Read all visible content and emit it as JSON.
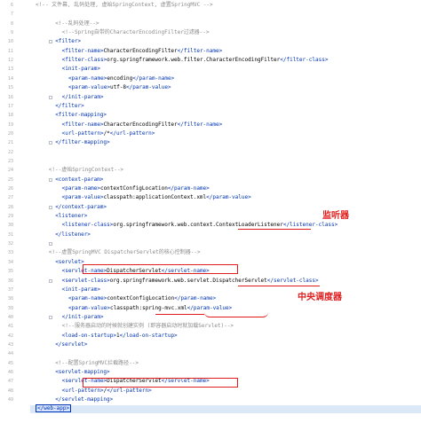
{
  "editor": {
    "line_numbers": [
      "6",
      "7",
      "8",
      "9",
      "10",
      "11",
      "12",
      "13",
      "14",
      "15",
      "16",
      "17",
      "18",
      "19",
      "20",
      "21",
      "22",
      "23",
      "24",
      "25",
      "26",
      "27",
      "28",
      "29",
      "30",
      "31",
      "32",
      "33",
      "34",
      "35",
      "36",
      "37",
      "38",
      "39",
      "40",
      "41",
      "42",
      "43",
      "44",
      "45",
      "46",
      "47",
      "48",
      "49"
    ],
    "lines": [
      {
        "kind": "comment",
        "indent": 0,
        "parts": [
          {
            "t": "com",
            "v": "<!-- 文件幕, 乱码处理, 虚始SpringContext, 虚置SpringMVC -->"
          }
        ]
      },
      {
        "kind": "blank",
        "indent": 0,
        "parts": []
      },
      {
        "kind": "code",
        "indent": 6,
        "parts": [
          {
            "t": "com",
            "v": "<!--乱码处理-->"
          }
        ]
      },
      {
        "kind": "code",
        "indent": 8,
        "parts": [
          {
            "t": "com",
            "v": "<!--Spring自带的CharacterEncodingFilter过滤器-->"
          }
        ]
      },
      {
        "kind": "code",
        "indent": 6,
        "parts": [
          {
            "t": "tag",
            "v": "<filter>"
          }
        ]
      },
      {
        "kind": "code",
        "indent": 8,
        "parts": [
          {
            "t": "tag",
            "v": "<filter-name>"
          },
          {
            "t": "txt",
            "v": "CharacterEncodingFilter"
          },
          {
            "t": "tag",
            "v": "</filter-name>"
          }
        ]
      },
      {
        "kind": "code",
        "indent": 8,
        "parts": [
          {
            "t": "tag",
            "v": "<filter-class>"
          },
          {
            "t": "txt",
            "v": "org.springframework.web.filter.CharacterEncodingFilter"
          },
          {
            "t": "tag",
            "v": "</filter-class>"
          }
        ]
      },
      {
        "kind": "code",
        "indent": 8,
        "parts": [
          {
            "t": "tag",
            "v": "<init-param>"
          }
        ]
      },
      {
        "kind": "code",
        "indent": 10,
        "parts": [
          {
            "t": "tag",
            "v": "<param-name>"
          },
          {
            "t": "txt",
            "v": "encoding"
          },
          {
            "t": "tag",
            "v": "</param-name>"
          }
        ]
      },
      {
        "kind": "code",
        "indent": 10,
        "parts": [
          {
            "t": "tag",
            "v": "<param-value>"
          },
          {
            "t": "txt",
            "v": "utf-8"
          },
          {
            "t": "tag",
            "v": "</param-value>"
          }
        ]
      },
      {
        "kind": "code",
        "indent": 8,
        "parts": [
          {
            "t": "tag",
            "v": "</init-param>"
          }
        ]
      },
      {
        "kind": "code",
        "indent": 6,
        "parts": [
          {
            "t": "tag",
            "v": "</filter>"
          }
        ]
      },
      {
        "kind": "code",
        "indent": 6,
        "parts": [
          {
            "t": "tag",
            "v": "<filter-mapping>"
          }
        ]
      },
      {
        "kind": "code",
        "indent": 8,
        "parts": [
          {
            "t": "tag",
            "v": "<filter-name>"
          },
          {
            "t": "txt",
            "v": "CharacterEncodingFilter"
          },
          {
            "t": "tag",
            "v": "</filter-name>"
          }
        ]
      },
      {
        "kind": "code",
        "indent": 8,
        "parts": [
          {
            "t": "tag",
            "v": "<url-pattern>"
          },
          {
            "t": "txt",
            "v": "/*"
          },
          {
            "t": "tag",
            "v": "</url-pattern>"
          }
        ]
      },
      {
        "kind": "code",
        "indent": 6,
        "parts": [
          {
            "t": "tag",
            "v": "</filter-mapping>"
          }
        ]
      },
      {
        "kind": "blank",
        "indent": 0,
        "parts": []
      },
      {
        "kind": "blank",
        "indent": 0,
        "parts": []
      },
      {
        "kind": "code",
        "indent": 4,
        "parts": [
          {
            "t": "com",
            "v": "<!--虚始SpringContext-->"
          }
        ]
      },
      {
        "kind": "code",
        "indent": 6,
        "parts": [
          {
            "t": "tag",
            "v": "<context-param>"
          }
        ]
      },
      {
        "kind": "code",
        "indent": 8,
        "parts": [
          {
            "t": "tag",
            "v": "<param-name>"
          },
          {
            "t": "txt",
            "v": "contextConfigLocation"
          },
          {
            "t": "tag",
            "v": "</param-name>"
          }
        ]
      },
      {
        "kind": "code",
        "indent": 8,
        "parts": [
          {
            "t": "tag",
            "v": "<param-value>"
          },
          {
            "t": "txt",
            "v": "classpath:applicationContext.xml"
          },
          {
            "t": "tag",
            "v": "</param-value>"
          }
        ]
      },
      {
        "kind": "code",
        "indent": 6,
        "parts": [
          {
            "t": "tag",
            "v": "</context-param>"
          }
        ]
      },
      {
        "kind": "code",
        "indent": 6,
        "parts": [
          {
            "t": "tag",
            "v": "<listener>"
          }
        ]
      },
      {
        "kind": "code",
        "indent": 8,
        "parts": [
          {
            "t": "tag",
            "v": "<listener-class>"
          },
          {
            "t": "txt",
            "v": "org.springframework.web.context.ContextLoaderListener"
          },
          {
            "t": "tag",
            "v": "</listener-class>"
          }
        ]
      },
      {
        "kind": "code",
        "indent": 6,
        "parts": [
          {
            "t": "tag",
            "v": "</listener>"
          }
        ]
      },
      {
        "kind": "blank",
        "indent": 0,
        "parts": []
      },
      {
        "kind": "code",
        "indent": 4,
        "parts": [
          {
            "t": "com",
            "v": "<!--虚置SpringMVC DispatcherServlet的核心控制器-->"
          }
        ]
      },
      {
        "kind": "code",
        "indent": 6,
        "parts": [
          {
            "t": "tag",
            "v": "<servlet>"
          }
        ]
      },
      {
        "kind": "code",
        "indent": 8,
        "parts": [
          {
            "t": "tag",
            "v": "<servlet-name>"
          },
          {
            "t": "txt",
            "v": "DispatcherServlet"
          },
          {
            "t": "tag",
            "v": "</servlet-name>"
          }
        ]
      },
      {
        "kind": "code",
        "indent": 8,
        "parts": [
          {
            "t": "tag",
            "v": "<servlet-class>"
          },
          {
            "t": "txt",
            "v": "org.springframework.web.servlet.DispatcherServlet"
          },
          {
            "t": "tag",
            "v": "</servlet-class>"
          }
        ]
      },
      {
        "kind": "code",
        "indent": 8,
        "parts": [
          {
            "t": "tag",
            "v": "<init-param>"
          }
        ]
      },
      {
        "kind": "code",
        "indent": 10,
        "parts": [
          {
            "t": "tag",
            "v": "<param-name>"
          },
          {
            "t": "txt",
            "v": "contextConfigLocation"
          },
          {
            "t": "tag",
            "v": "</param-name>"
          }
        ]
      },
      {
        "kind": "code",
        "indent": 10,
        "parts": [
          {
            "t": "tag",
            "v": "<param-value>"
          },
          {
            "t": "txt",
            "v": "classpath:spring-mvc.xml"
          },
          {
            "t": "tag",
            "v": "</param-value>"
          }
        ]
      },
      {
        "kind": "code",
        "indent": 8,
        "parts": [
          {
            "t": "tag",
            "v": "</init-param>"
          }
        ]
      },
      {
        "kind": "code",
        "indent": 8,
        "parts": [
          {
            "t": "com",
            "v": "<!--服务器启动的时候就创建实例 (即容器启动时就加载Servlet)-->"
          }
        ]
      },
      {
        "kind": "code",
        "indent": 8,
        "parts": [
          {
            "t": "tag",
            "v": "<load-on-startup>"
          },
          {
            "t": "txt",
            "v": "1"
          },
          {
            "t": "tag",
            "v": "</load-on-startup>"
          }
        ]
      },
      {
        "kind": "code",
        "indent": 6,
        "parts": [
          {
            "t": "tag",
            "v": "</servlet>"
          }
        ]
      },
      {
        "kind": "blank",
        "indent": 0,
        "parts": []
      },
      {
        "kind": "code",
        "indent": 6,
        "parts": [
          {
            "t": "com",
            "v": "<!--配置SpringMVC拦截路径-->"
          }
        ]
      },
      {
        "kind": "code",
        "indent": 6,
        "parts": [
          {
            "t": "tag",
            "v": "<servlet-mapping>"
          }
        ]
      },
      {
        "kind": "code",
        "indent": 8,
        "parts": [
          {
            "t": "tag",
            "v": "<servlet-name>"
          },
          {
            "t": "txt",
            "v": "DispatcherServlet"
          },
          {
            "t": "tag",
            "v": "</servlet-name>"
          }
        ]
      },
      {
        "kind": "code",
        "indent": 8,
        "parts": [
          {
            "t": "tag",
            "v": "<url-pattern>"
          },
          {
            "t": "txt",
            "v": "/"
          },
          {
            "t": "tag",
            "v": "</url-pattern>"
          }
        ]
      },
      {
        "kind": "code",
        "indent": 6,
        "parts": [
          {
            "t": "tag",
            "v": "</servlet-mapping>"
          }
        ]
      },
      {
        "kind": "code",
        "indent": 0,
        "parts": [
          {
            "t": "tag",
            "v": "</web-app>"
          }
        ]
      }
    ]
  },
  "annotations": {
    "listener_label": "监听器",
    "dispatcher_label": "中央调度器"
  },
  "colors": {
    "tag": "#0033b3",
    "comment": "#8c8c8c",
    "annotation": "#e01e1e",
    "current_line": "#dbe8f8"
  }
}
